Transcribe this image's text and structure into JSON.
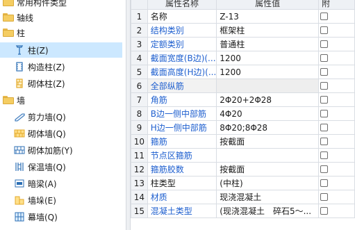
{
  "tree": {
    "items": [
      {
        "label": "常用构件类型",
        "level": 0,
        "icon": "folder-icon"
      },
      {
        "label": "轴线",
        "level": 0,
        "icon": "folder-icon"
      },
      {
        "label": "柱",
        "level": 0,
        "icon": "folder-open-icon"
      },
      {
        "label": "柱(Z)",
        "level": 1,
        "icon": "column-icon",
        "selected": true
      },
      {
        "label": "构造柱(Z)",
        "level": 1,
        "icon": "constructional-column-icon"
      },
      {
        "label": "砌体柱(Z)",
        "level": 1,
        "icon": "masonry-column-icon"
      },
      {
        "label": "墙",
        "level": 0,
        "icon": "folder-open-icon"
      },
      {
        "label": "剪力墙(Q)",
        "level": 1,
        "icon": "shear-wall-icon"
      },
      {
        "label": "砌体墙(Q)",
        "level": 1,
        "icon": "masonry-wall-icon"
      },
      {
        "label": "砌体加筋(Y)",
        "level": 1,
        "icon": "masonry-rebar-icon"
      },
      {
        "label": "保温墙(Q)",
        "level": 1,
        "icon": "insulation-wall-icon"
      },
      {
        "label": "暗梁(A)",
        "level": 1,
        "icon": "hidden-beam-icon"
      },
      {
        "label": "墙垛(E)",
        "level": 1,
        "icon": "wall-pier-icon"
      },
      {
        "label": "幕墙(Q)",
        "level": 1,
        "icon": "curtain-wall-icon"
      }
    ]
  },
  "grid": {
    "headers": {
      "name": "属性名称",
      "value": "属性值",
      "attach": "附"
    },
    "rows": [
      {
        "num": "1",
        "name": "名称",
        "value": "Z-13",
        "blue": false,
        "shaded": false
      },
      {
        "num": "2",
        "name": "结构类别",
        "value": "框架柱",
        "blue": true,
        "shaded": false
      },
      {
        "num": "3",
        "name": "定额类别",
        "value": "普通柱",
        "blue": true,
        "shaded": false
      },
      {
        "num": "4",
        "name": "截面宽度(B边)(...",
        "value": "1200",
        "blue": true,
        "shaded": false
      },
      {
        "num": "5",
        "name": "截面高度(H边)(...",
        "value": "1200",
        "blue": true,
        "shaded": false
      },
      {
        "num": "6",
        "name": "全部纵筋",
        "value": "",
        "blue": true,
        "shaded": true
      },
      {
        "num": "7",
        "name": "角筋",
        "value": "2Φ20+2Φ28",
        "blue": true,
        "shaded": false
      },
      {
        "num": "8",
        "name": "B边一侧中部筋",
        "value": "4Φ20",
        "blue": true,
        "shaded": false
      },
      {
        "num": "9",
        "name": "H边一侧中部筋",
        "value": "8Φ20;8Φ28",
        "blue": true,
        "shaded": false
      },
      {
        "num": "10",
        "name": "箍筋",
        "value": "按截面",
        "blue": true,
        "shaded": false
      },
      {
        "num": "11",
        "name": "节点区箍筋",
        "value": "",
        "blue": true,
        "shaded": false
      },
      {
        "num": "12",
        "name": "箍筋胶数",
        "value": "按截面",
        "blue": true,
        "shaded": false
      },
      {
        "num": "13",
        "name": "柱类型",
        "value": "(中柱)",
        "blue": false,
        "shaded": false
      },
      {
        "num": "14",
        "name": "材质",
        "value": "现浇混凝土",
        "blue": true,
        "shaded": false
      },
      {
        "num": "15",
        "name": "混凝土类型",
        "value": "(现浇混凝土　碎石5～...",
        "blue": true,
        "shaded": false
      }
    ]
  },
  "colors": {
    "selection": "#cce8ff",
    "blue_text": "#1e5fcf",
    "folder": "#f5cd62"
  }
}
